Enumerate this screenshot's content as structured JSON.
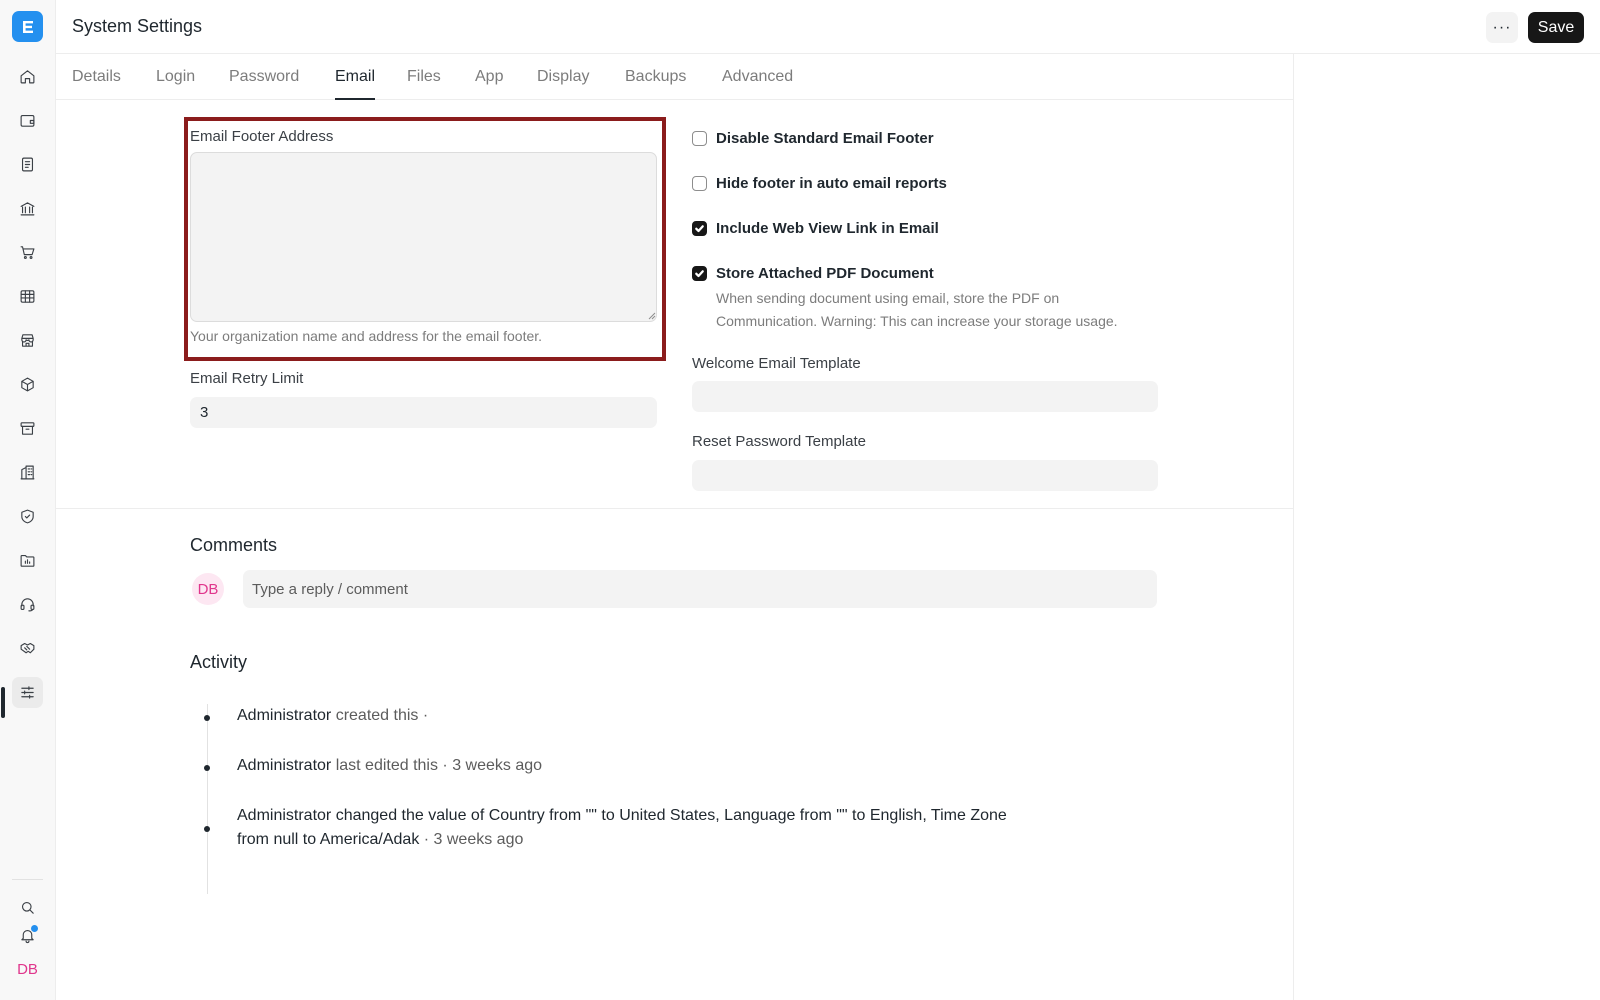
{
  "header": {
    "title": "System Settings",
    "more_label": "···",
    "save_label": "Save"
  },
  "sidebar": {
    "logo_letter": "E",
    "items": [
      {
        "icon": "home-icon"
      },
      {
        "icon": "wallet-icon"
      },
      {
        "icon": "document-icon"
      },
      {
        "icon": "bank-icon"
      },
      {
        "icon": "cart-icon"
      },
      {
        "icon": "table-icon"
      },
      {
        "icon": "store-icon"
      },
      {
        "icon": "box-icon"
      },
      {
        "icon": "archive-icon"
      },
      {
        "icon": "building-icon"
      },
      {
        "icon": "shield-icon"
      },
      {
        "icon": "folder-chart-icon"
      },
      {
        "icon": "headset-icon"
      },
      {
        "icon": "handshake-icon"
      },
      {
        "icon": "settings-sliders-icon"
      }
    ],
    "user_initials": "DB"
  },
  "tabs": [
    "Details",
    "Login",
    "Password",
    "Email",
    "Files",
    "App",
    "Display",
    "Backups",
    "Advanced"
  ],
  "active_tab": "Email",
  "form": {
    "footer_address_label": "Email Footer Address",
    "footer_address_value": "",
    "footer_address_help": "Your organization name and address for the email footer.",
    "retry_limit_label": "Email Retry Limit",
    "retry_limit_value": "3",
    "checkboxes": [
      {
        "label": "Disable Standard Email Footer",
        "checked": false
      },
      {
        "label": "Hide footer in auto email reports",
        "checked": false
      },
      {
        "label": "Include Web View Link in Email",
        "checked": true
      },
      {
        "label": "Store Attached PDF Document",
        "checked": true
      }
    ],
    "store_pdf_help_line1": "When sending document using email, store the PDF on",
    "store_pdf_help_line2": "Communication. Warning: This can increase your storage usage.",
    "welcome_template_label": "Welcome Email Template",
    "welcome_template_value": "",
    "reset_template_label": "Reset Password Template",
    "reset_template_value": ""
  },
  "comments": {
    "title": "Comments",
    "avatar_initials": "DB",
    "placeholder": "Type a reply / comment"
  },
  "activity": {
    "title": "Activity",
    "entries": [
      {
        "actor": "Administrator",
        "text": " created this ·"
      },
      {
        "actor": "Administrator",
        "text": " last edited this · 3 weeks ago"
      },
      {
        "p1": "Administrator changed the value of Country from \"\" to ",
        "v1": "United States",
        "p2": ", Language from \"\" to ",
        "v2": "English",
        "p3": ", Time Zone from ",
        "v3": "null",
        "p4": " to ",
        "v4": "America/Adak",
        "p5": " · 3 weeks ago"
      }
    ]
  },
  "colors": {
    "accent": "#2490ef",
    "highlight_border": "#8b1c1c",
    "avatar_pink": "#e0368c"
  }
}
